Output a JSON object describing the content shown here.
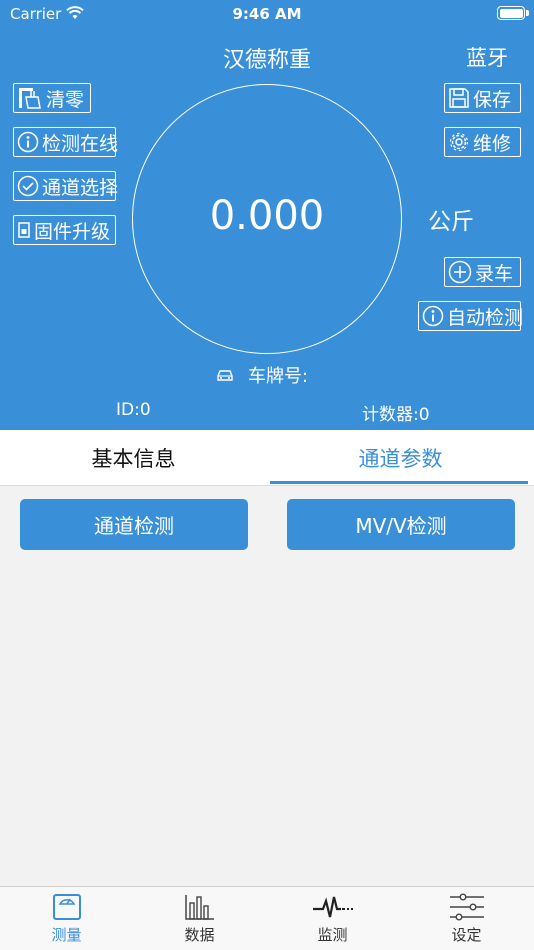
{
  "status_bar": {
    "carrier": "Carrier",
    "time": "9:46 AM"
  },
  "nav": {
    "title": "汉德称重",
    "right_button": "蓝牙"
  },
  "left_buttons": [
    {
      "label": "清零",
      "icon": "broom-icon"
    },
    {
      "label": "检测在线",
      "icon": "info-icon"
    },
    {
      "label": "通道选择",
      "icon": "check-circle-icon"
    },
    {
      "label": "固件升级",
      "icon": "chip-icon"
    }
  ],
  "right_buttons": [
    {
      "label": "保存",
      "icon": "floppy-icon"
    },
    {
      "label": "维修",
      "icon": "gear-icon"
    },
    {
      "label": "录车",
      "icon": "plus-circle-icon"
    },
    {
      "label": "自动检测",
      "icon": "info-icon"
    }
  ],
  "display": {
    "weight": "0.000",
    "unit": "公斤",
    "plate_label": "车牌号:"
  },
  "info": {
    "id": "ID:0",
    "counter": "计数器:0"
  },
  "tabs": [
    {
      "label": "基本信息",
      "active": false
    },
    {
      "label": "通道参数",
      "active": true
    }
  ],
  "actions": {
    "channel_check": "通道检测",
    "mvv_check": "MV/V检测"
  },
  "bottom_nav": [
    {
      "label": "测量",
      "icon": "scale-icon",
      "active": true
    },
    {
      "label": "数据",
      "icon": "bar-chart-icon",
      "active": false
    },
    {
      "label": "监测",
      "icon": "pulse-icon",
      "active": false
    },
    {
      "label": "设定",
      "icon": "sliders-icon",
      "active": false
    }
  ],
  "colors": {
    "primary": "#3a90d8",
    "background": "#f2f2f2"
  }
}
